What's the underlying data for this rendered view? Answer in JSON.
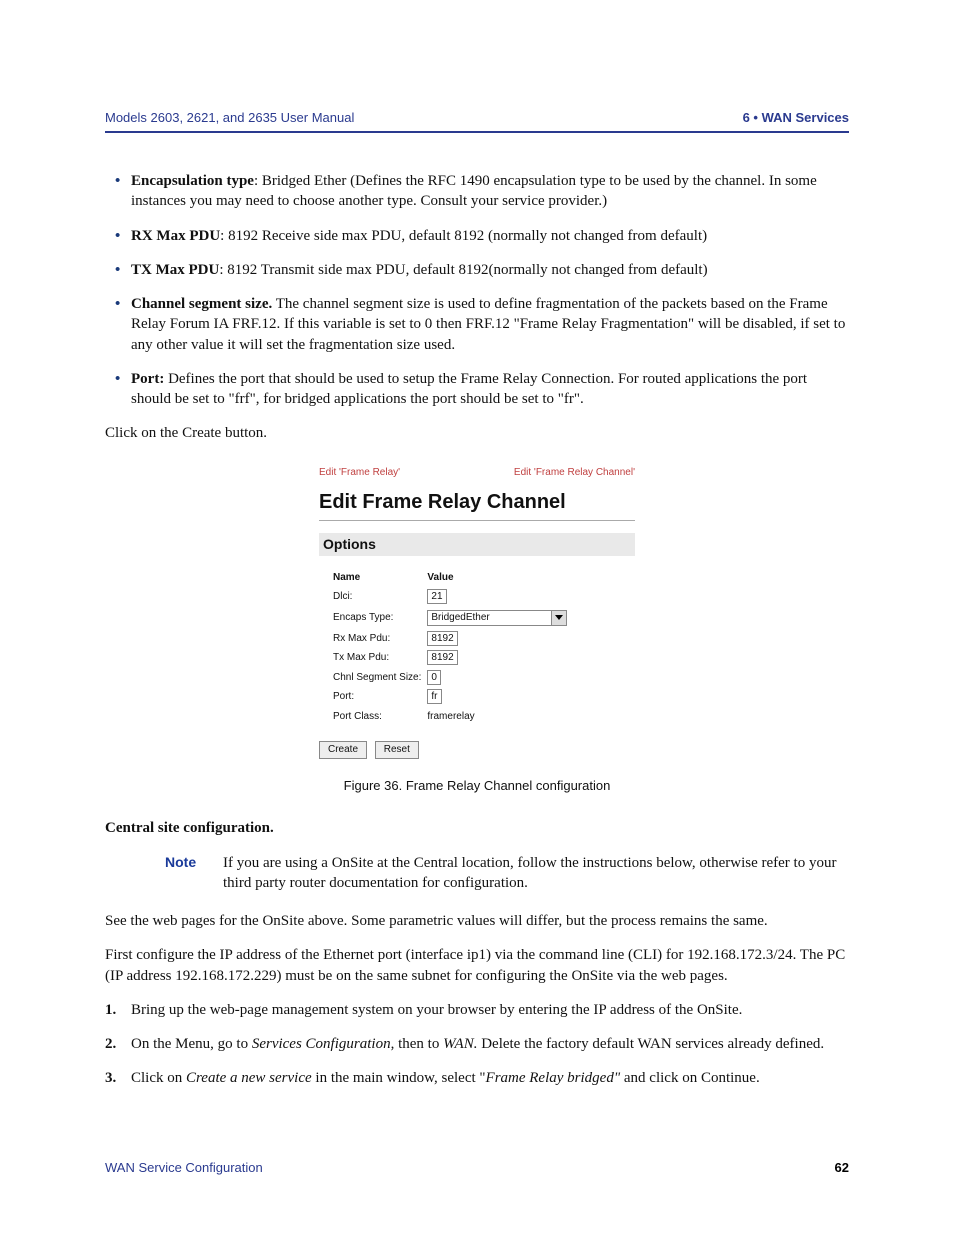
{
  "header": {
    "left": "Models 2603, 2621, and 2635 User Manual",
    "right": "6 • WAN Services"
  },
  "bullets": [
    {
      "bold": "Encapsulation type",
      "text": ": Bridged Ether (Defines the RFC 1490 encapsulation type to be used by the channel. In some instances you may need to choose another type. Consult your service provider.)"
    },
    {
      "bold": "RX Max PDU",
      "text": ": 8192 Receive side max PDU, default 8192 (normally not changed from default)"
    },
    {
      "bold": "TX Max PDU",
      "text": ": 8192 Transmit side max PDU, default 8192(normally not changed from default)"
    },
    {
      "bold": "Channel segment size.",
      "text": " The channel segment size is used to define fragmentation of the packets based on the Frame Relay Forum IA FRF.12. If this variable is set to 0 then FRF.12 \"Frame Relay Fragmentation\" will be disabled, if set to any other value it will set the fragmentation size used."
    },
    {
      "bold": "Port:",
      "text": " Defines the port that should be used to setup the Frame Relay Connection. For routed applications the port should be set to \"frf\", for bridged applications the port should be set to \"fr\"."
    }
  ],
  "click_create": "Click on the Create button.",
  "figure": {
    "crumb_left": "Edit 'Frame Relay'",
    "crumb_right": "Edit 'Frame Relay Channel'",
    "title": "Edit Frame Relay Channel",
    "subtitle": "Options",
    "col_name": "Name",
    "col_value": "Value",
    "rows": {
      "dlci": {
        "label": "Dlci:",
        "value": "21"
      },
      "encaps": {
        "label": "Encaps Type:",
        "value": "BridgedEther"
      },
      "rxmax": {
        "label": "Rx Max Pdu:",
        "value": "8192"
      },
      "txmax": {
        "label": "Tx Max Pdu:",
        "value": "8192"
      },
      "chnl": {
        "label": "Chnl Segment Size:",
        "value": "0"
      },
      "port": {
        "label": "Port:",
        "value": "fr"
      },
      "pclass": {
        "label": "Port Class:",
        "value": "framerelay"
      }
    },
    "btn_create": "Create",
    "btn_reset": "Reset",
    "caption": "Figure 36. Frame Relay Channel configuration"
  },
  "central_heading": "Central site configuration.",
  "note": {
    "label": "Note",
    "text": "If you are using a OnSite at the Central location, follow the instructions below, otherwise refer to your third party router documentation for configuration."
  },
  "para_see": "See the web pages for the OnSite above. Some parametric values will differ, but the process remains the same.",
  "para_first": "First configure the IP address of the Ethernet port (interface ip1) via the command line (CLI) for 192.168.172.3/24. The PC (IP address 192.168.172.229) must be on the same subnet for configuring the OnSite via the web pages.",
  "steps": {
    "s1": {
      "num": "1.",
      "text": "Bring up the web-page management system on your browser by entering the IP address of the OnSite."
    },
    "s2": {
      "num": "2.",
      "pre": "On the Menu, go to ",
      "ital1": "Services Configuration",
      "mid": ", then to ",
      "ital2": "WAN.",
      "post": " Delete the factory default WAN services already defined."
    },
    "s3": {
      "num": "3.",
      "pre": "Click on ",
      "ital1": "Create a new service",
      "mid": " in the main window, select \"",
      "ital2": "Frame Relay bridged\"",
      "post": " and click on Continue."
    }
  },
  "footer": {
    "left": "WAN Service Configuration",
    "right": "62"
  }
}
